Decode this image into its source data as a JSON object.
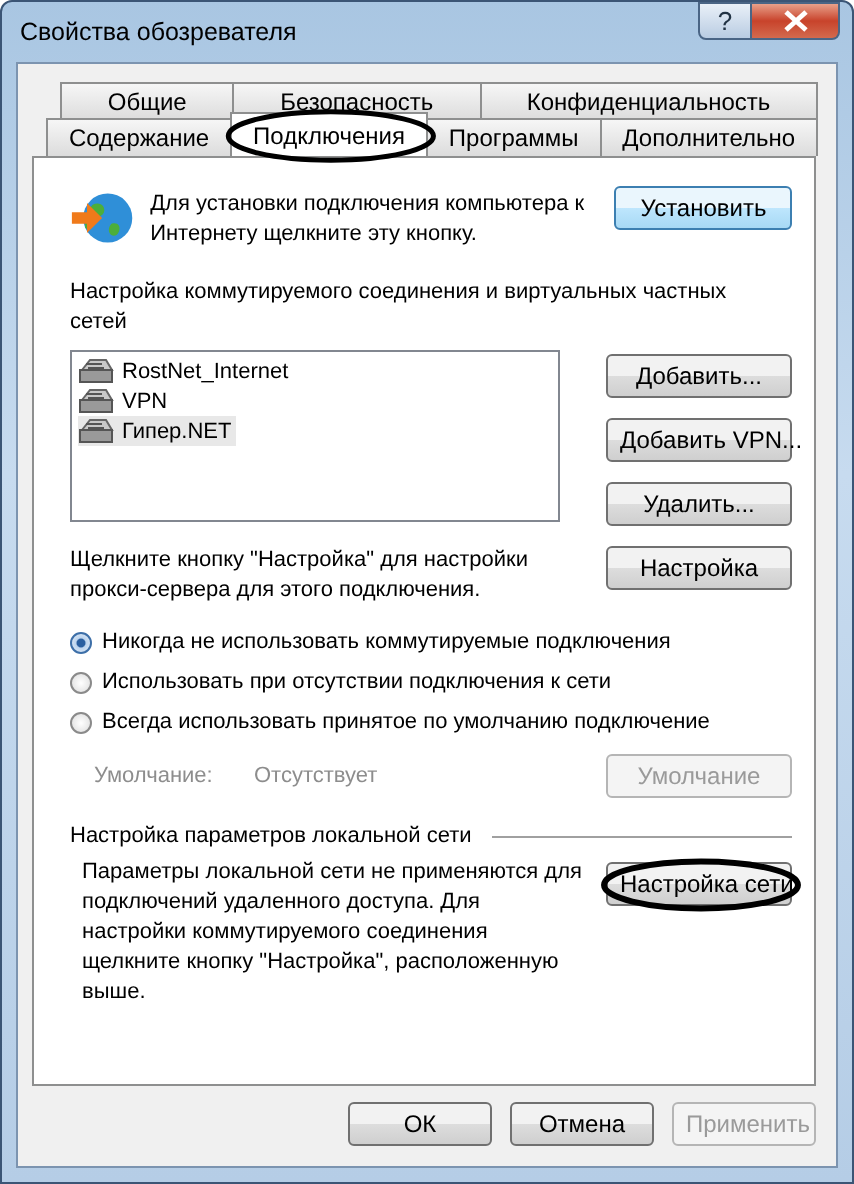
{
  "window": {
    "title": "Свойства обозревателя",
    "help_label": "?"
  },
  "tab_rows": [
    [
      {
        "label": "Общие",
        "selected": false,
        "circled": false
      },
      {
        "label": "Безопасность",
        "selected": false,
        "circled": false
      },
      {
        "label": "Конфиденциальность",
        "selected": false,
        "circled": false
      }
    ],
    [
      {
        "label": "Содержание",
        "selected": false,
        "circled": false
      },
      {
        "label": "Подключения",
        "selected": true,
        "circled": true
      },
      {
        "label": "Программы",
        "selected": false,
        "circled": false
      },
      {
        "label": "Дополнительно",
        "selected": false,
        "circled": false
      }
    ]
  ],
  "setup": {
    "text": "Для установки подключения компьютера к Интернету щелкните эту кнопку.",
    "button": "Установить"
  },
  "dialup": {
    "heading": "Настройка коммутируемого соединения и виртуальных частных сетей",
    "connections": [
      {
        "name": "RostNet_Internet",
        "selected": false
      },
      {
        "name": "VPN",
        "selected": false
      },
      {
        "name": "Гипер.NET",
        "selected": true
      }
    ],
    "buttons": [
      "Добавить...",
      "Добавить VPN...",
      "Удалить..."
    ],
    "proxy_text": "Щелкните кнопку \"Настройка\" для настройки прокси-сервера для этого подключения.",
    "settings_button": "Настройка"
  },
  "radios": [
    {
      "label": "Никогда не использовать коммутируемые подключения",
      "selected": true
    },
    {
      "label": "Использовать при отсутствии подключения к сети",
      "selected": false
    },
    {
      "label": "Всегда использовать принятое по умолчанию подключение",
      "selected": false
    }
  ],
  "default": {
    "label": "Умолчание:",
    "value": "Отсутствует",
    "button": "Умолчание",
    "disabled": true
  },
  "lan": {
    "heading": "Настройка параметров локальной сети",
    "text": "Параметры локальной сети не применяются для подключений удаленного доступа. Для настройки коммутируемого соединения щелкните кнопку \"Настройка\", расположенную выше.",
    "button": "Настройка сети",
    "circled": true
  },
  "footer_buttons": [
    {
      "label": "ОК",
      "disabled": false
    },
    {
      "label": "Отмена",
      "disabled": false
    },
    {
      "label": "Применить",
      "disabled": true
    }
  ]
}
